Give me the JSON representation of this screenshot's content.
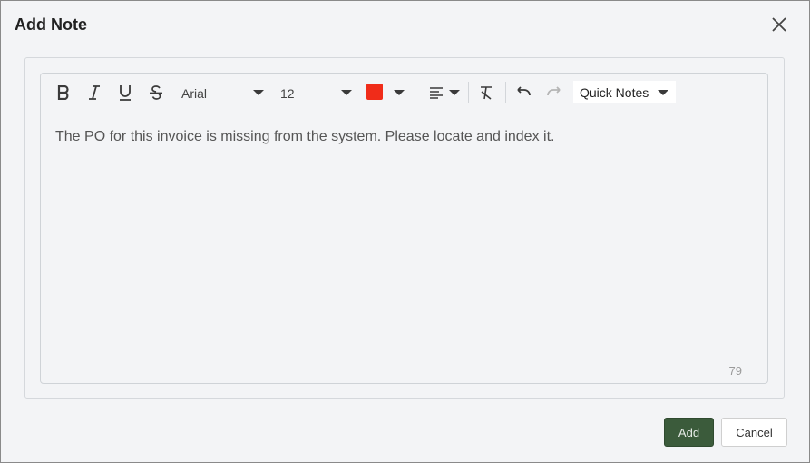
{
  "dialog": {
    "title": "Add Note",
    "close_icon": "close-icon"
  },
  "toolbar": {
    "bold_icon": "bold-icon",
    "italic_icon": "italic-icon",
    "underline_icon": "underline-icon",
    "strikethrough_icon": "strikethrough-icon",
    "font_family": "Arial",
    "font_size": "12",
    "text_color": "#f02c19",
    "align_icon": "align-left-icon",
    "clear_format_icon": "clear-format-icon",
    "undo_icon": "undo-icon",
    "redo_icon": "redo-icon",
    "quick_notes_label": "Quick Notes"
  },
  "editor": {
    "content": "The PO for this invoice is missing from the system. Please locate and index it.",
    "char_count": "79"
  },
  "actions": {
    "add_label": "Add",
    "cancel_label": "Cancel",
    "add_color": "#3b5b3b"
  }
}
